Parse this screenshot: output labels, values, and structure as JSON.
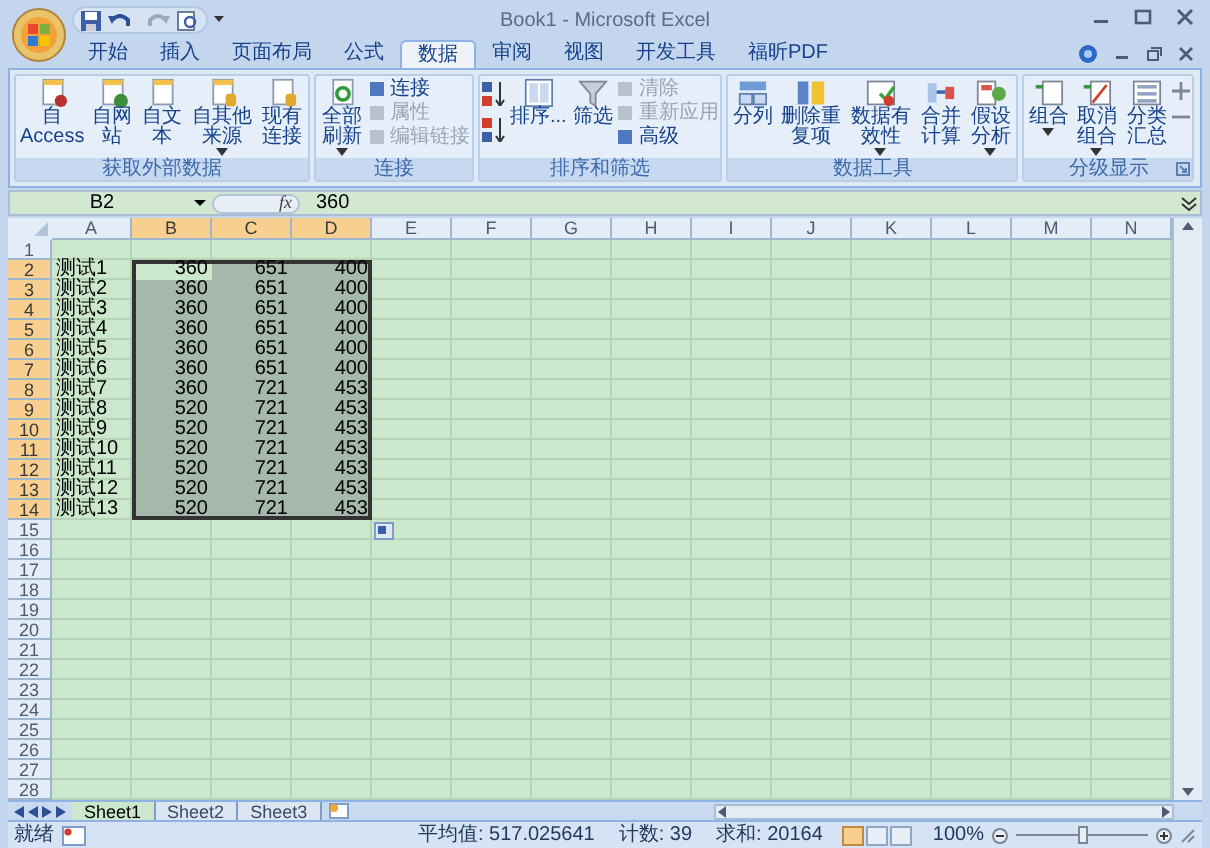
{
  "window": {
    "title": "Book1 - Microsoft Excel"
  },
  "ribbon_tabs": [
    {
      "label": "开始",
      "selected": false
    },
    {
      "label": "插入",
      "selected": false
    },
    {
      "label": "页面布局",
      "selected": false
    },
    {
      "label": "公式",
      "selected": false
    },
    {
      "label": "数据",
      "selected": true
    },
    {
      "label": "审阅",
      "selected": false
    },
    {
      "label": "视图",
      "selected": false
    },
    {
      "label": "开发工具",
      "selected": false
    },
    {
      "label": "福昕PDF",
      "selected": false
    }
  ],
  "ribbon_groups": [
    {
      "label": "获取外部数据",
      "dialog_launcher": false,
      "items": [
        {
          "kind": "large",
          "label": "自 Access",
          "dropdown": false
        },
        {
          "kind": "large",
          "label": "自网站",
          "dropdown": false
        },
        {
          "kind": "large",
          "label": "自文本",
          "dropdown": false
        },
        {
          "kind": "large",
          "label": "自其他来源",
          "dropdown": true
        },
        {
          "kind": "large",
          "label": "现有连接",
          "dropdown": false
        }
      ]
    },
    {
      "label": "连接",
      "dialog_launcher": false,
      "items": [
        {
          "kind": "large",
          "label": "全部刷新",
          "dropdown": true
        },
        {
          "kind": "small_stack",
          "entries": [
            {
              "label": "连接",
              "disabled": false
            },
            {
              "label": "属性",
              "disabled": true
            },
            {
              "label": "编辑链接",
              "disabled": true
            }
          ]
        }
      ]
    },
    {
      "label": "排序和筛选",
      "dialog_launcher": false,
      "items": [
        {
          "kind": "sort_stack"
        },
        {
          "kind": "large",
          "label": "排序...",
          "dropdown": false
        },
        {
          "kind": "large",
          "label": "筛选",
          "dropdown": false
        },
        {
          "kind": "small_stack",
          "entries": [
            {
              "label": "清除",
              "disabled": true
            },
            {
              "label": "重新应用",
              "disabled": true
            },
            {
              "label": "高级",
              "disabled": false
            }
          ]
        }
      ]
    },
    {
      "label": "数据工具",
      "dialog_launcher": false,
      "items": [
        {
          "kind": "large",
          "label": "分列",
          "dropdown": false
        },
        {
          "kind": "large",
          "label": "删除重复项",
          "dropdown": false
        },
        {
          "kind": "large",
          "label": "数据有效性",
          "dropdown": true
        },
        {
          "kind": "large",
          "label": "合并计算",
          "dropdown": false
        },
        {
          "kind": "large",
          "label": "假设分析",
          "dropdown": true
        }
      ]
    },
    {
      "label": "分级显示",
      "dialog_launcher": true,
      "items": [
        {
          "kind": "large",
          "label": "组合",
          "dropdown": true
        },
        {
          "kind": "large",
          "label": "取消组合",
          "dropdown": true
        },
        {
          "kind": "large",
          "label": "分类汇总",
          "dropdown": false
        },
        {
          "kind": "detail_stack"
        }
      ]
    }
  ],
  "formula_bar": {
    "name_box": "B2",
    "function_label": "fx",
    "value": "360"
  },
  "columns": [
    {
      "label": "A",
      "selected": false
    },
    {
      "label": "B",
      "selected": true
    },
    {
      "label": "C",
      "selected": true
    },
    {
      "label": "D",
      "selected": true
    },
    {
      "label": "E",
      "selected": false
    },
    {
      "label": "F",
      "selected": false
    },
    {
      "label": "G",
      "selected": false
    },
    {
      "label": "H",
      "selected": false
    },
    {
      "label": "I",
      "selected": false
    },
    {
      "label": "J",
      "selected": false
    },
    {
      "label": "K",
      "selected": false
    },
    {
      "label": "L",
      "selected": false
    },
    {
      "label": "M",
      "selected": false
    },
    {
      "label": "N",
      "selected": false
    }
  ],
  "rows": [
    {
      "header": "1",
      "selected": false
    },
    {
      "header": "2",
      "selected": true,
      "cells": [
        "测试1",
        "360",
        "651",
        "400"
      ]
    },
    {
      "header": "3",
      "selected": true,
      "cells": [
        "测试2",
        "360",
        "651",
        "400"
      ]
    },
    {
      "header": "4",
      "selected": true,
      "cells": [
        "测试3",
        "360",
        "651",
        "400"
      ]
    },
    {
      "header": "5",
      "selected": true,
      "cells": [
        "测试4",
        "360",
        "651",
        "400"
      ]
    },
    {
      "header": "6",
      "selected": true,
      "cells": [
        "测试5",
        "360",
        "651",
        "400"
      ]
    },
    {
      "header": "7",
      "selected": true,
      "cells": [
        "测试6",
        "360",
        "651",
        "400"
      ]
    },
    {
      "header": "8",
      "selected": true,
      "cells": [
        "测试7",
        "360",
        "721",
        "453"
      ]
    },
    {
      "header": "9",
      "selected": true,
      "cells": [
        "测试8",
        "520",
        "721",
        "453"
      ]
    },
    {
      "header": "10",
      "selected": true,
      "cells": [
        "测试9",
        "520",
        "721",
        "453"
      ]
    },
    {
      "header": "11",
      "selected": true,
      "cells": [
        "测试10",
        "520",
        "721",
        "453"
      ]
    },
    {
      "header": "12",
      "selected": true,
      "cells": [
        "测试11",
        "520",
        "721",
        "453"
      ]
    },
    {
      "header": "13",
      "selected": true,
      "cells": [
        "测试12",
        "520",
        "721",
        "453"
      ]
    },
    {
      "header": "14",
      "selected": true,
      "cells": [
        "测试13",
        "520",
        "721",
        "453"
      ]
    },
    {
      "header": "15",
      "selected": false
    },
    {
      "header": "16",
      "selected": false
    },
    {
      "header": "17",
      "selected": false
    },
    {
      "header": "18",
      "selected": false
    },
    {
      "header": "19",
      "selected": false
    },
    {
      "header": "20",
      "selected": false
    },
    {
      "header": "21",
      "selected": false
    },
    {
      "header": "22",
      "selected": false
    },
    {
      "header": "23",
      "selected": false
    },
    {
      "header": "24",
      "selected": false
    },
    {
      "header": "25",
      "selected": false
    },
    {
      "header": "26",
      "selected": false
    },
    {
      "header": "27",
      "selected": false
    },
    {
      "header": "28",
      "selected": false
    }
  ],
  "sheet_tabs": [
    {
      "label": "Sheet1",
      "selected": true
    },
    {
      "label": "Sheet2",
      "selected": false
    },
    {
      "label": "Sheet3",
      "selected": false
    }
  ],
  "status_bar": {
    "mode": "就绪",
    "average": "平均值: 517.025641",
    "count": "计数: 39",
    "sum": "求和: 20164",
    "views": [
      {
        "selected": true
      },
      {
        "selected": false
      },
      {
        "selected": false
      }
    ],
    "zoom": "100%",
    "zoom_slider": {
      "level": 0.5
    }
  }
}
